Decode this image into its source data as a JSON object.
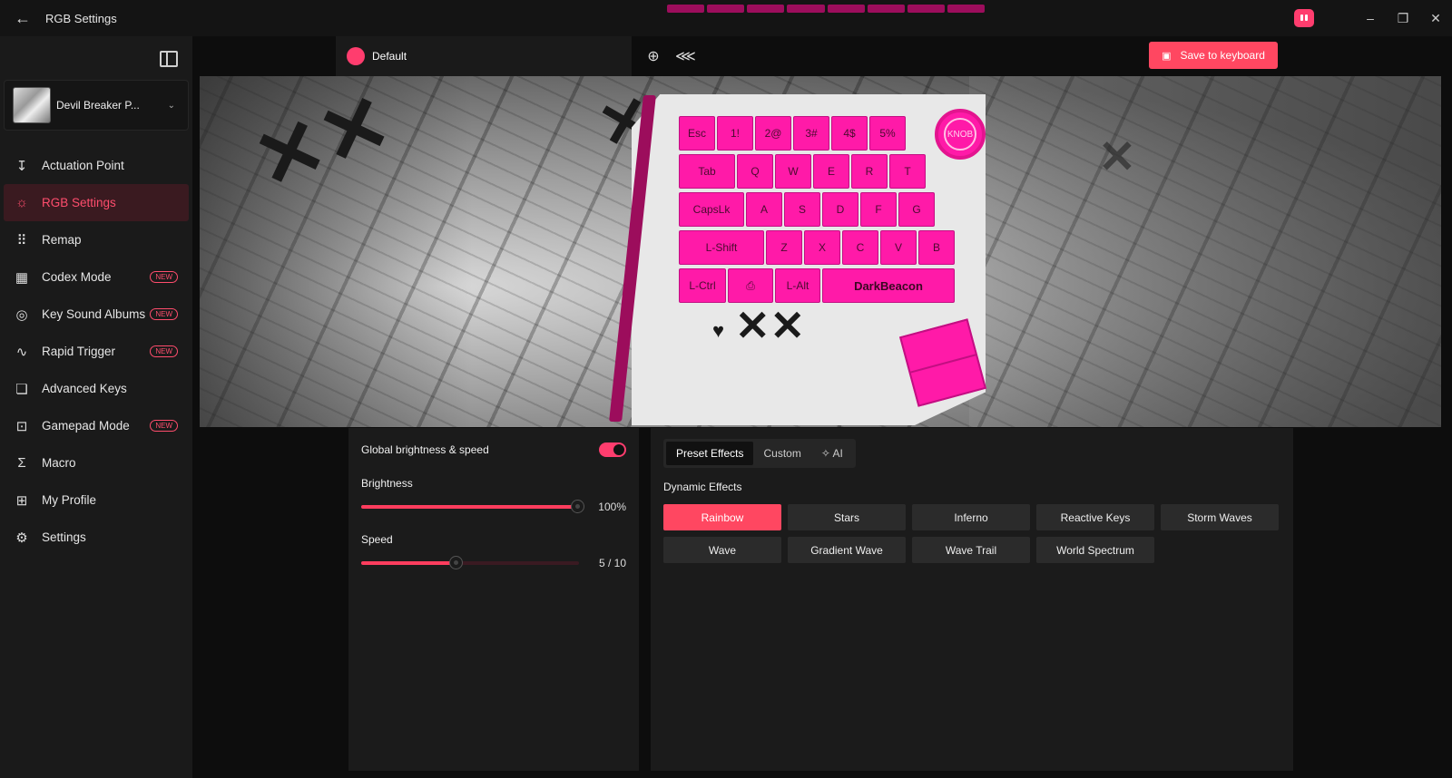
{
  "window": {
    "title": "RGB Settings",
    "back_glyph": "←",
    "minimize": "–",
    "restore": "❐",
    "close": "✕"
  },
  "sidebar": {
    "device_name": "Devil Breaker P...",
    "new_badge": "NEW",
    "items": [
      {
        "label": "Actuation Point",
        "icon": "↧",
        "new": false,
        "active": false
      },
      {
        "label": "RGB Settings",
        "icon": "☼",
        "new": false,
        "active": true
      },
      {
        "label": "Remap",
        "icon": "⠿",
        "new": false,
        "active": false
      },
      {
        "label": "Codex Mode",
        "icon": "▦",
        "new": true,
        "active": false
      },
      {
        "label": "Key Sound Albums",
        "icon": "◎",
        "new": true,
        "active": false
      },
      {
        "label": "Rapid Trigger",
        "icon": "∿",
        "new": true,
        "active": false
      },
      {
        "label": "Advanced Keys",
        "icon": "❏",
        "new": false,
        "active": false
      },
      {
        "label": "Gamepad Mode",
        "icon": "⊡",
        "new": true,
        "active": false
      },
      {
        "label": "Macro",
        "icon": "Σ",
        "new": false,
        "active": false
      },
      {
        "label": "My Profile",
        "icon": "⊞",
        "new": false,
        "active": false
      },
      {
        "label": "Settings",
        "icon": "⚙",
        "new": false,
        "active": false
      }
    ]
  },
  "toolbar": {
    "profile_name": "Default",
    "profile_color": "#ff3d6e",
    "globe_icon": "⊕",
    "share_icon": "⋘",
    "save_label": "Save to keyboard",
    "save_icon": "▣"
  },
  "keyboard": {
    "rows": [
      [
        "Esc",
        "1!",
        "2@",
        "3#",
        "4$",
        "5%"
      ],
      [
        "Tab",
        "Q",
        "W",
        "E",
        "R",
        "T"
      ],
      [
        "CapsLk",
        "A",
        "S",
        "D",
        "F",
        "G"
      ],
      [
        "L-Shift",
        "Z",
        "X",
        "C",
        "V",
        "B"
      ],
      [
        "L-Ctrl",
        "",
        "L-Alt",
        "DarkBeacon"
      ]
    ],
    "knob_label": "KNOB",
    "key_color": "#ff1aa8"
  },
  "global": {
    "title": "Global brightness & speed",
    "toggle_on": true,
    "brightness_label": "Brightness",
    "brightness_value": "100%",
    "brightness_fraction": 1.0,
    "speed_label": "Speed",
    "speed_value": "5 / 10",
    "speed_fraction": 0.44
  },
  "effects_panel": {
    "tabs": [
      "Preset Effects",
      "Custom",
      "✧ AI"
    ],
    "active_tab": 0,
    "section": "Dynamic Effects",
    "effects": [
      "Rainbow",
      "Stars",
      "Inferno",
      "Reactive Keys",
      "Storm Waves",
      "Wave",
      "Gradient Wave",
      "Wave Trail",
      "World Spectrum"
    ],
    "active_effect": 0
  }
}
